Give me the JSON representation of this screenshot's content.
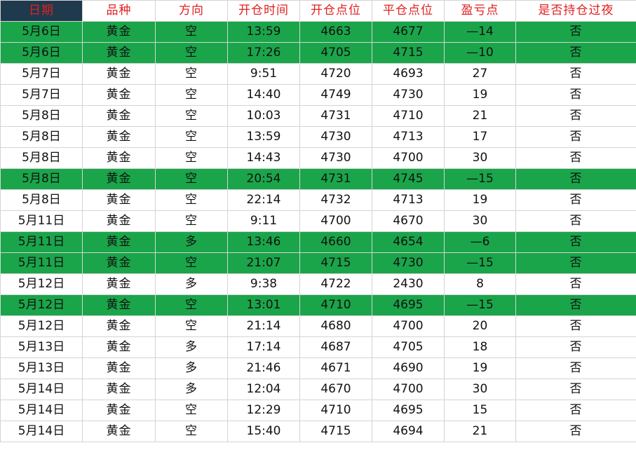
{
  "colors": {
    "header_text": "#e02020",
    "date_header_bg": "#1f3a4d",
    "loss_row_bg": "#1aa54a",
    "grid_line": "#d4d4d4"
  },
  "headers": [
    "日期",
    "品种",
    "方向",
    "开仓时间",
    "开仓点位",
    "平仓点位",
    "盈亏点",
    "是否持仓过夜"
  ],
  "rows": [
    {
      "date": "5月6日",
      "product": "黄金",
      "direction": "空",
      "open_time": "13:59",
      "open_price": "4663",
      "close_price": "4677",
      "pnl": "—14",
      "overnight": "否",
      "loss": true
    },
    {
      "date": "5月6日",
      "product": "黄金",
      "direction": "空",
      "open_time": "17:26",
      "open_price": "4705",
      "close_price": "4715",
      "pnl": "—10",
      "overnight": "否",
      "loss": true
    },
    {
      "date": "5月7日",
      "product": "黄金",
      "direction": "空",
      "open_time": "9:51",
      "open_price": "4720",
      "close_price": "4693",
      "pnl": "27",
      "overnight": "否",
      "loss": false
    },
    {
      "date": "5月7日",
      "product": "黄金",
      "direction": "空",
      "open_time": "14:40",
      "open_price": "4749",
      "close_price": "4730",
      "pnl": "19",
      "overnight": "否",
      "loss": false
    },
    {
      "date": "5月8日",
      "product": "黄金",
      "direction": "空",
      "open_time": "10:03",
      "open_price": "4731",
      "close_price": "4710",
      "pnl": "21",
      "overnight": "否",
      "loss": false
    },
    {
      "date": "5月8日",
      "product": "黄金",
      "direction": "空",
      "open_time": "13:59",
      "open_price": "4730",
      "close_price": "4713",
      "pnl": "17",
      "overnight": "否",
      "loss": false
    },
    {
      "date": "5月8日",
      "product": "黄金",
      "direction": "空",
      "open_time": "14:43",
      "open_price": "4730",
      "close_price": "4700",
      "pnl": "30",
      "overnight": "否",
      "loss": false
    },
    {
      "date": "5月8日",
      "product": "黄金",
      "direction": "空",
      "open_time": "20:54",
      "open_price": "4731",
      "close_price": "4745",
      "pnl": "—15",
      "overnight": "否",
      "loss": true
    },
    {
      "date": "5月8日",
      "product": "黄金",
      "direction": "空",
      "open_time": "22:14",
      "open_price": "4732",
      "close_price": "4713",
      "pnl": "19",
      "overnight": "否",
      "loss": false
    },
    {
      "date": "5月11日",
      "product": "黄金",
      "direction": "空",
      "open_time": "9:11",
      "open_price": "4700",
      "close_price": "4670",
      "pnl": "30",
      "overnight": "否",
      "loss": false
    },
    {
      "date": "5月11日",
      "product": "黄金",
      "direction": "多",
      "open_time": "13:46",
      "open_price": "4660",
      "close_price": "4654",
      "pnl": "—6",
      "overnight": "否",
      "loss": true
    },
    {
      "date": "5月11日",
      "product": "黄金",
      "direction": "空",
      "open_time": "21:07",
      "open_price": "4715",
      "close_price": "4730",
      "pnl": "—15",
      "overnight": "否",
      "loss": true
    },
    {
      "date": "5月12日",
      "product": "黄金",
      "direction": "多",
      "open_time": "9:38",
      "open_price": "4722",
      "close_price": "2430",
      "pnl": "8",
      "overnight": "否",
      "loss": false
    },
    {
      "date": "5月12日",
      "product": "黄金",
      "direction": "空",
      "open_time": "13:01",
      "open_price": "4710",
      "close_price": "4695",
      "pnl": "—15",
      "overnight": "否",
      "loss": true
    },
    {
      "date": "5月12日",
      "product": "黄金",
      "direction": "空",
      "open_time": "21:14",
      "open_price": "4680",
      "close_price": "4700",
      "pnl": "20",
      "overnight": "否",
      "loss": false
    },
    {
      "date": "5月13日",
      "product": "黄金",
      "direction": "多",
      "open_time": "17:14",
      "open_price": "4687",
      "close_price": "4705",
      "pnl": "18",
      "overnight": "否",
      "loss": false
    },
    {
      "date": "5月13日",
      "product": "黄金",
      "direction": "多",
      "open_time": "21:46",
      "open_price": "4671",
      "close_price": "4690",
      "pnl": "19",
      "overnight": "否",
      "loss": false
    },
    {
      "date": "5月14日",
      "product": "黄金",
      "direction": "多",
      "open_time": "12:04",
      "open_price": "4670",
      "close_price": "4700",
      "pnl": "30",
      "overnight": "否",
      "loss": false
    },
    {
      "date": "5月14日",
      "product": "黄金",
      "direction": "空",
      "open_time": "12:29",
      "open_price": "4710",
      "close_price": "4695",
      "pnl": "15",
      "overnight": "否",
      "loss": false
    },
    {
      "date": "5月14日",
      "product": "黄金",
      "direction": "空",
      "open_time": "15:40",
      "open_price": "4715",
      "close_price": "4694",
      "pnl": "21",
      "overnight": "否",
      "loss": false
    }
  ]
}
